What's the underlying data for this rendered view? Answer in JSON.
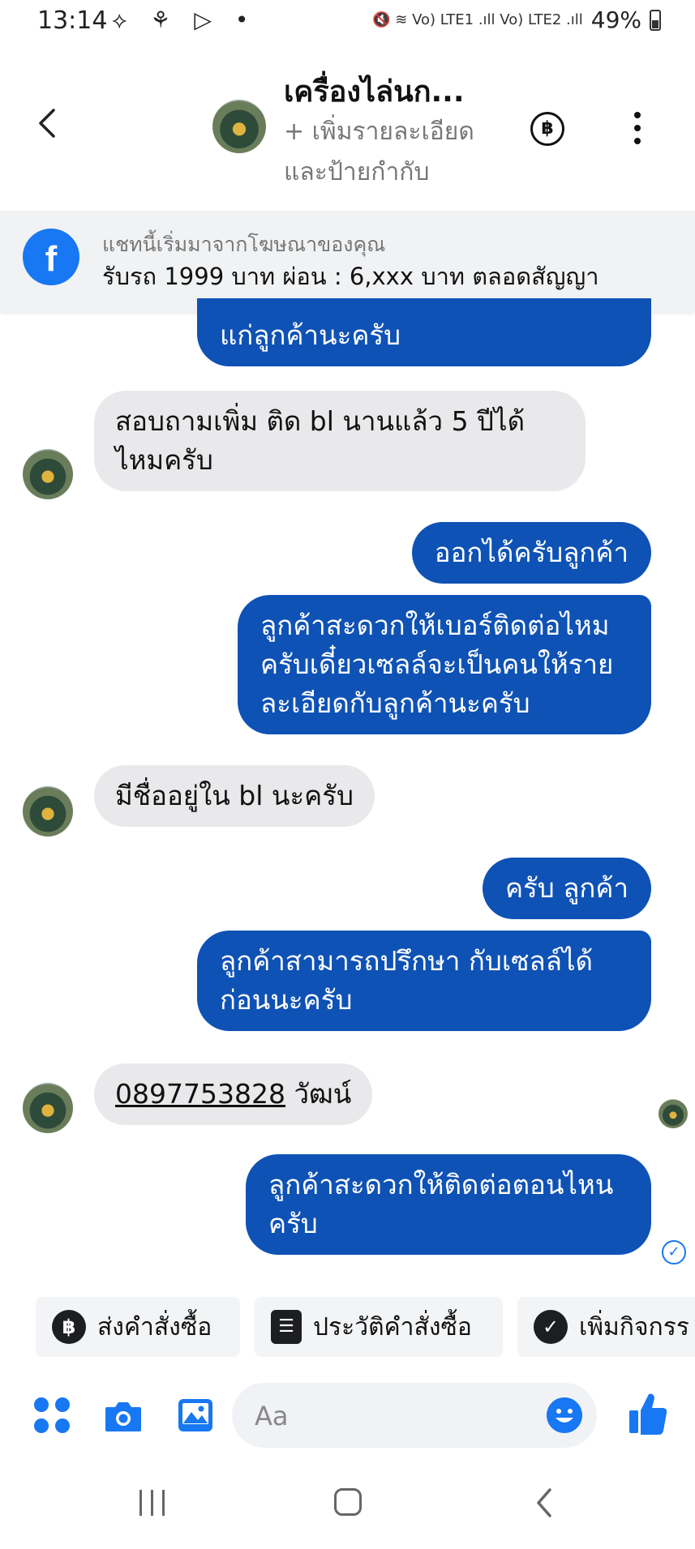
{
  "status_bar": {
    "time": "13:14",
    "left_icons": "⟡ ⚘ ▷ •",
    "signal_text": "🔇 ≋ Vo) LTE1 .ıll Vo) LTE2 .ıll",
    "battery": "49%"
  },
  "header": {
    "title": "เครื่องไล่นก...",
    "subtitle": "+ เพิ่มรายละเอียดและป้ายกำกับ",
    "baht_symbol": "฿"
  },
  "ad_banner": {
    "caption": "แชทนี้เริ่มมาจากโฆษณาของคุณ",
    "text": "รับรถ 1999 บาท ผ่อน : 6,xxx บาท ตลอดสัญญา",
    "logo": "f"
  },
  "messages": [
    {
      "side": "out",
      "text": "แก่ลูกค้านะครับ"
    },
    {
      "side": "in",
      "text": "สอบถามเพิ่ม ติด bl นานแล้ว 5 ปีได้ไหมครับ"
    },
    {
      "side": "out",
      "text": "ออกได้ครับลูกค้า"
    },
    {
      "side": "out",
      "text": "ลูกค้าสะดวกให้เบอร์ติดต่อไหมครับเดี๋ยวเซลล์จะเป็นคนให้รายละเอียดกับลูกค้านะครับ"
    },
    {
      "side": "in",
      "text": "มีชื่ออยู่ใน bl นะครับ"
    },
    {
      "side": "out",
      "text": "ครับ ลูกค้า"
    },
    {
      "side": "out",
      "text": "ลูกค้าสามารถปรึกษา กับเซลล์ได้ก่อนนะครับ"
    },
    {
      "side": "in",
      "phone": "0897753828",
      "text": " วัฒน์"
    },
    {
      "side": "out",
      "text": "ลูกค้าสะดวกให้ติดต่อตอนไหนครับ"
    }
  ],
  "read_check": "✓",
  "quick_actions": [
    {
      "icon": "฿",
      "label": "ส่งคำสั่งซื้อ"
    },
    {
      "icon": "☰",
      "label": "ประวัติคำสั่งซื้อ"
    },
    {
      "icon": "✓",
      "label": "เพิ่มกิจกรร"
    }
  ],
  "composer": {
    "placeholder": "Aa"
  },
  "colors": {
    "outgoing_bubble": "#0f52b5",
    "incoming_bubble": "#e9e9eb",
    "accent": "#1877f2"
  }
}
